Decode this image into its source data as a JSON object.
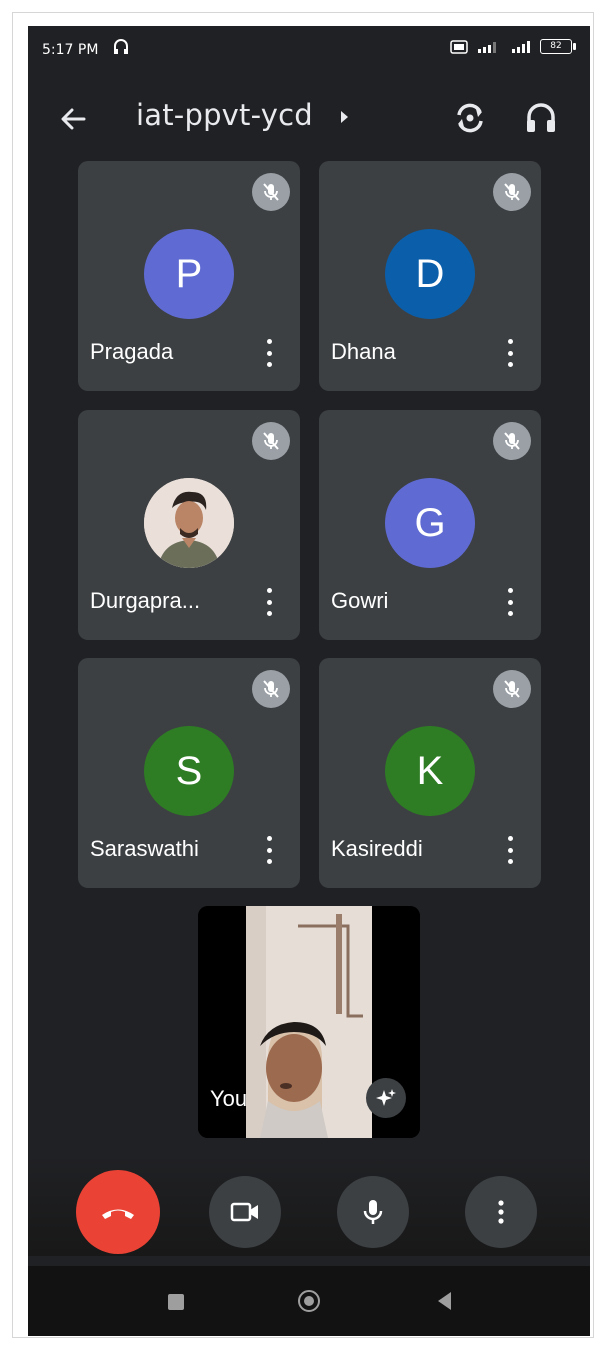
{
  "status_bar": {
    "time": "5:17 PM",
    "battery": "82"
  },
  "header": {
    "meeting_code": "iat-ppvt-ycd"
  },
  "participants": [
    {
      "name": "Pragada",
      "initial": "P",
      "color": "#5f6bd3",
      "muted": true,
      "has_photo": false
    },
    {
      "name": "Dhana",
      "initial": "D",
      "color": "#0b5eaa",
      "muted": true,
      "has_photo": false
    },
    {
      "name": "Durgapra...",
      "initial": "",
      "color": "#e9dcd6",
      "muted": true,
      "has_photo": true
    },
    {
      "name": "Gowri",
      "initial": "G",
      "color": "#5f6bd3",
      "muted": true,
      "has_photo": false
    },
    {
      "name": "Saraswathi",
      "initial": "S",
      "color": "#2e7d24",
      "muted": true,
      "has_photo": false
    },
    {
      "name": "Kasireddi",
      "initial": "K",
      "color": "#2e7d24",
      "muted": true,
      "has_photo": false
    }
  ],
  "self_view": {
    "label": "You"
  },
  "controls": {
    "end_call_color": "#ea4335",
    "icons": [
      "end-call-icon",
      "camera-icon",
      "microphone-icon",
      "more-options-icon"
    ]
  },
  "icons": {
    "back": "back-arrow-icon",
    "switch_camera": "switch-camera-icon",
    "audio_output": "headphones-icon",
    "muted": "mic-off-icon",
    "effects": "sparkle-effects-icon"
  }
}
